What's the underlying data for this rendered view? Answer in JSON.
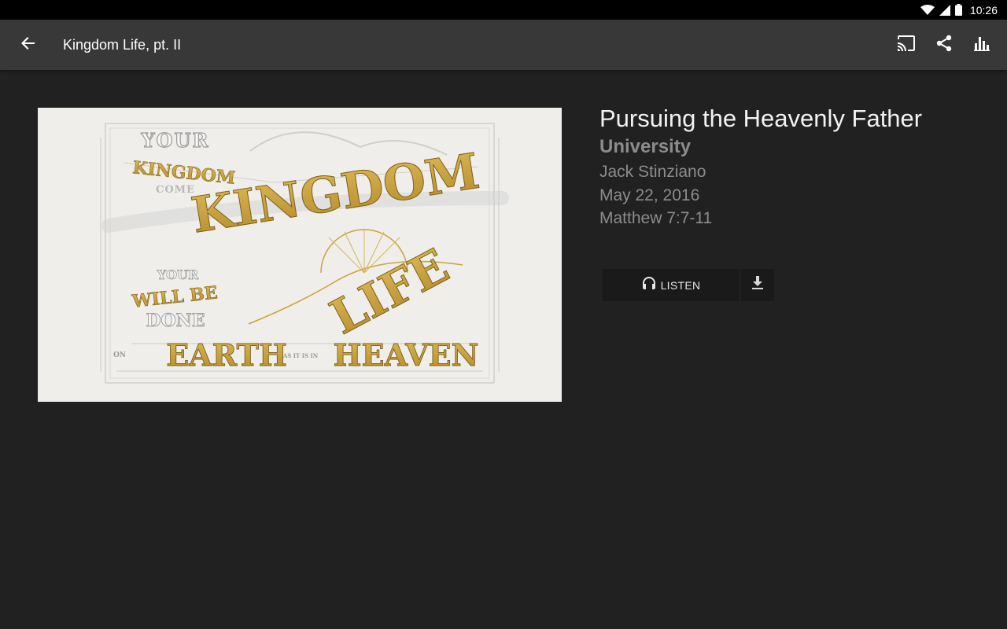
{
  "status_bar": {
    "time": "10:26",
    "icons": [
      "wifi-icon",
      "signal-icon",
      "battery-icon"
    ]
  },
  "app_bar": {
    "title": "Kingdom Life, pt. II",
    "back_icon": "arrow-back-icon",
    "actions": [
      "cast-icon",
      "share-icon",
      "equalizer-icon"
    ]
  },
  "artwork": {
    "lines": {
      "your": "YOUR",
      "kingdom_small": "KINGDOM",
      "come": "COME",
      "kingdom_large": "KINGDOM",
      "life": "LIFE",
      "your2": "YOUR",
      "will_be": "WILL BE",
      "done": "DONE",
      "on": "ON",
      "earth": "EARTH",
      "as_it_is_in": "AS IT IS IN",
      "heaven": "HEAVEN"
    }
  },
  "sermon": {
    "title": "Pursuing the Heavenly Father",
    "series": "University",
    "speaker": "Jack Stinziano",
    "date": "May 22, 2016",
    "passage": "Matthew 7:7-11"
  },
  "buttons": {
    "listen": "LISTEN",
    "listen_icon": "headphones-icon",
    "download_icon": "download-icon"
  },
  "colors": {
    "background": "#212121",
    "app_bar": "#383838",
    "gold": "#c9a23a",
    "muted_text": "#8c8c8c"
  }
}
